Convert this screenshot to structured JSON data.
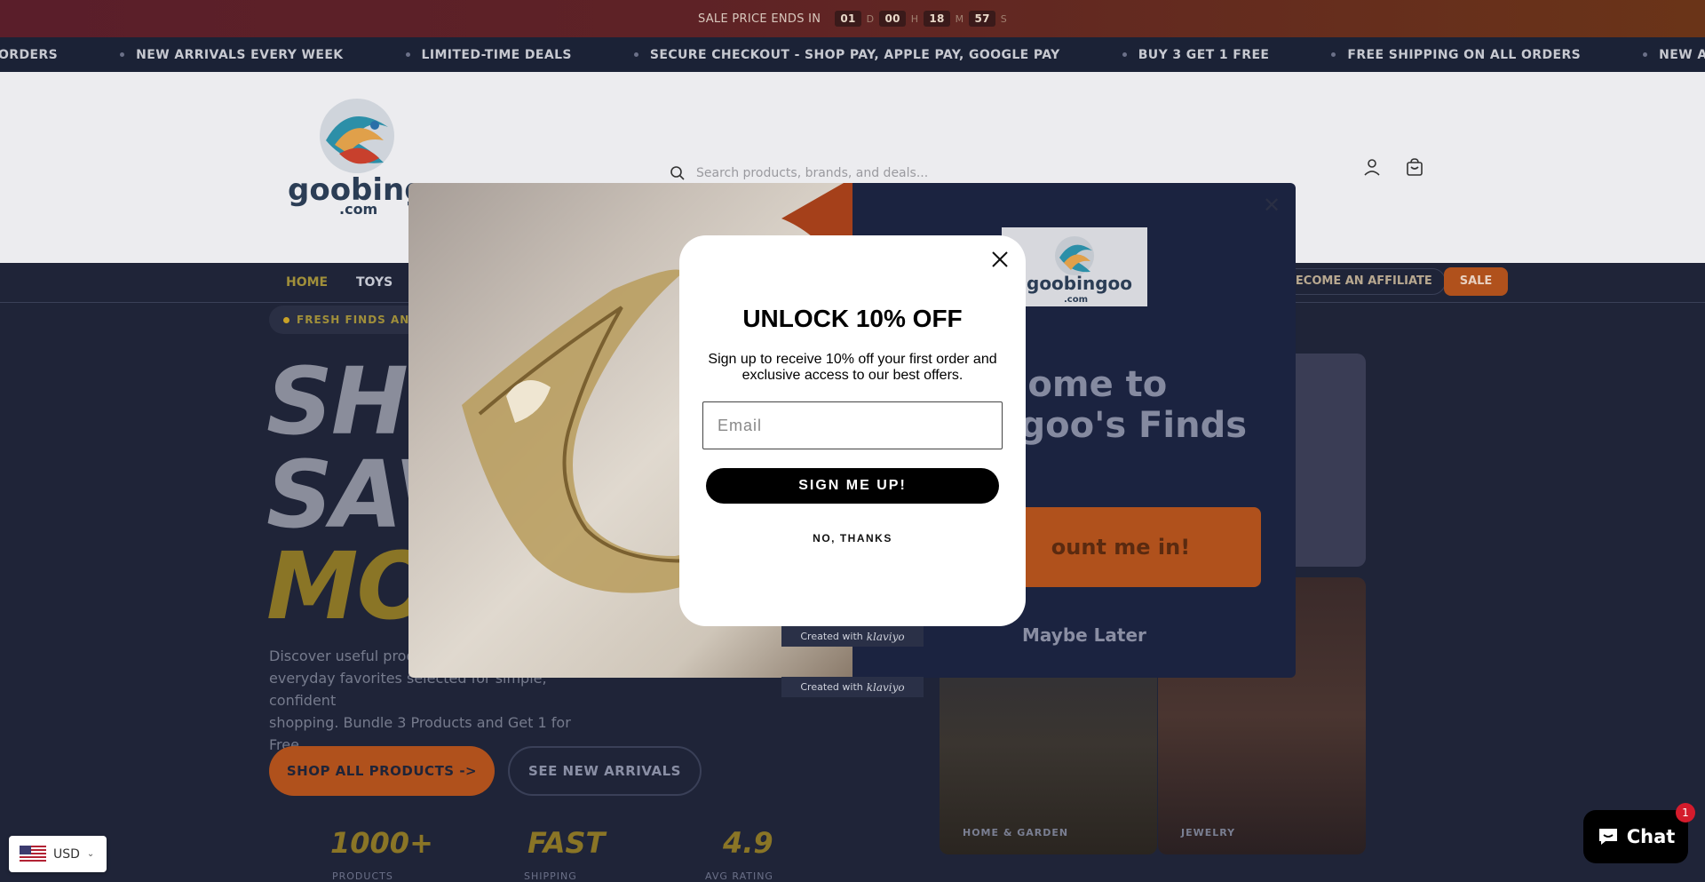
{
  "promo_bar": {
    "text": "SALE PRICE ENDS IN",
    "countdown": [
      {
        "value": "01",
        "unit": "D"
      },
      {
        "value": "00",
        "unit": "H"
      },
      {
        "value": "18",
        "unit": "M"
      },
      {
        "value": "57",
        "unit": "S"
      }
    ]
  },
  "marquee": {
    "items": [
      "ORDERS",
      "NEW ARRIVALS EVERY WEEK",
      "LIMITED-TIME DEALS",
      "SECURE CHECKOUT - SHOP PAY, APPLE PAY, GOOGLE PAY",
      "BUY 3 GET 1 FREE",
      "FREE SHIPPING ON ALL ORDERS",
      "NEW ARRIVALS EVERY WEEK"
    ]
  },
  "header": {
    "logo_text": "goobingoo",
    "logo_sub": ".com",
    "search_placeholder": "Search products, brands, and deals..."
  },
  "nav": {
    "items": [
      "HOME",
      "TOYS"
    ],
    "affiliate": "BECOME AN AFFILIATE",
    "sale": "SALE"
  },
  "hero": {
    "pill": "FRESH FINDS AND",
    "line1": "SHO",
    "line2": "SAV",
    "line3": "MOR",
    "description": "Discover useful produ... everyday favorites selected for simple, confident shopping. Bundle 3 Products and Get 1 for Free.",
    "desc_line1": "Discover useful produ",
    "desc_line2": "everyday favorites selected for simple, confident",
    "desc_line3": "shopping. Bundle 3 Products and Get 1 for Free.",
    "btn_shop": "SHOP ALL PRODUCTS ->",
    "btn_new": "SEE NEW ARRIVALS",
    "stats": [
      {
        "value": "1000+",
        "label": "PRODUCTS"
      },
      {
        "value": "FAST",
        "label": "SHIPPING"
      },
      {
        "value": "4.9",
        "label": "AVG RATING"
      }
    ],
    "tiles": [
      {
        "label": "HOME & GARDEN"
      },
      {
        "label": "JEWELRY"
      }
    ]
  },
  "welcome_modal": {
    "title_line1": "lcome to",
    "title_line2": "ngoo's Finds",
    "cta": "ount me in!",
    "maybe": "Maybe Later"
  },
  "klaviyo": {
    "created_with": "Created with",
    "brand": "klaviyo"
  },
  "popup": {
    "title": "UNLOCK 10% OFF",
    "subtitle": "Sign up to receive 10% off your first order and exclusive access to our best offers.",
    "email_placeholder": "Email",
    "submit": "SIGN ME UP!",
    "decline": "NO, THANKS"
  },
  "currency": {
    "code": "USD"
  },
  "chat": {
    "label": "Chat",
    "badge": "1"
  },
  "colors": {
    "accent": "#b0511c",
    "gold": "#c9a227",
    "navy": "#1f2438"
  }
}
